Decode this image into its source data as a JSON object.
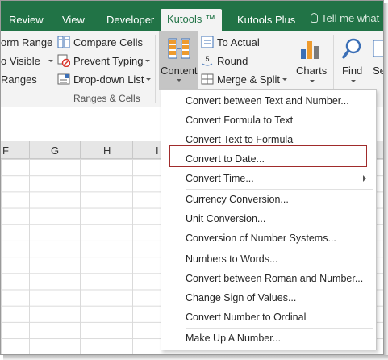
{
  "tabs": {
    "review": "Review",
    "view": "View",
    "developer": "Developer",
    "kutools": "Kutools ™",
    "kutools_plus": "Kutools Plus",
    "tell_me": "Tell me what"
  },
  "ribbon": {
    "form_range": "orm Range",
    "to_visible": "o Visible",
    "ranges": "Ranges",
    "compare_cells": "Compare Cells",
    "prevent_typing": "Prevent Typing",
    "dropdown_list": "Drop-down List",
    "to_actual": "To Actual",
    "round": "Round",
    "merge_split": "Merge & Split",
    "content": "Content",
    "charts": "Charts",
    "find": "Find",
    "se": "Se",
    "group_label": "Ranges & Cells"
  },
  "columns": [
    "F",
    "G",
    "H",
    "I"
  ],
  "menu": {
    "items": [
      "Convert between Text and Number...",
      "Convert Formula to Text",
      "Convert Text to Formula",
      "Convert to Date...",
      "Convert Time...",
      "Currency Conversion...",
      "Unit Conversion...",
      "Conversion of Number Systems...",
      "Numbers to Words...",
      "Convert between Roman and Number...",
      "Change Sign of Values...",
      "Convert Number to Ordinal",
      "Make Up A Number..."
    ],
    "highlighted_item": "Convert to Date..."
  },
  "colors": {
    "tab_bar": "#217346",
    "highlight_border": "#a02b2b",
    "content_button_bg": "#c5c5c5"
  }
}
